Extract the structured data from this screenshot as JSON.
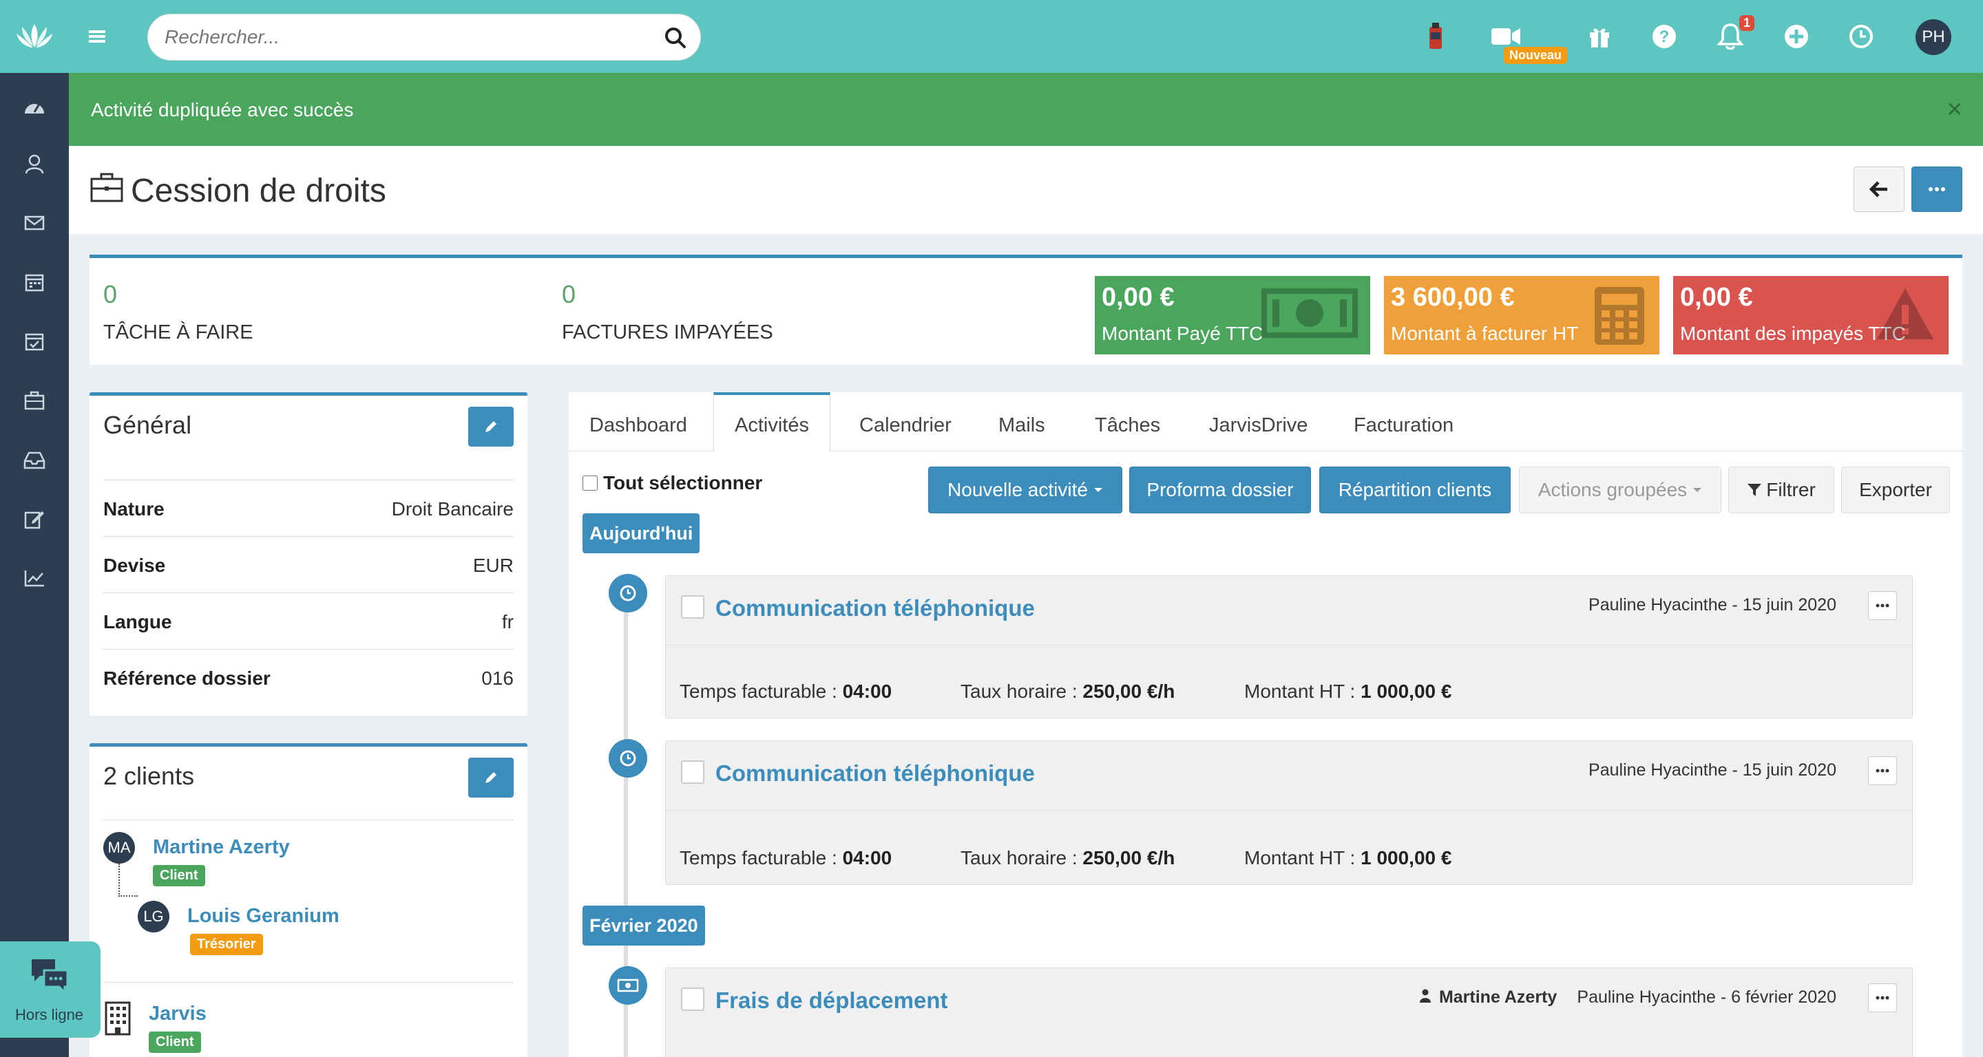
{
  "header": {
    "search_placeholder": "Rechercher...",
    "new_badge": "Nouveau",
    "notif_count": "1",
    "user_initials": "PH"
  },
  "alert": {
    "message": "Activité dupliquée avec succès",
    "close": "×"
  },
  "page": {
    "title": "Cession de droits"
  },
  "stats": {
    "tasks_count": "0",
    "tasks_label": "TÂCHE À FAIRE",
    "invoices_count": "0",
    "invoices_label": "FACTURES IMPAYÉES",
    "kpis": [
      {
        "value": "0,00 €",
        "label": "Montant Payé TTC",
        "color": "#4aa55d"
      },
      {
        "value": "3 600,00 €",
        "label": "Montant à facturer HT",
        "color": "#f0a03a"
      },
      {
        "value": "0,00 €",
        "label": "Montant des impayés TTC",
        "color": "#d9534f"
      }
    ]
  },
  "general": {
    "title": "Général",
    "rows": [
      {
        "key": "Nature",
        "value": "Droit Bancaire"
      },
      {
        "key": "Devise",
        "value": "EUR"
      },
      {
        "key": "Langue",
        "value": "fr"
      },
      {
        "key": "Référence dossier",
        "value": "016"
      }
    ]
  },
  "clients": {
    "title": "2 clients",
    "list": [
      {
        "initials": "MA",
        "name": "Martine Azerty",
        "role": "Client",
        "role_color": "#4aa55d"
      },
      {
        "initials": "LG",
        "name": "Louis Geranium",
        "role": "Trésorier",
        "role_color": "#f39c12"
      },
      {
        "name": "Jarvis",
        "role": "Client",
        "role_color": "#4aa55d"
      }
    ]
  },
  "chat": {
    "label": "Hors ligne"
  },
  "tabs": [
    "Dashboard",
    "Activités",
    "Calendrier",
    "Mails",
    "Tâches",
    "JarvisDrive",
    "Facturation"
  ],
  "toolbar": {
    "select_all": "Tout sélectionner",
    "new_activity": "Nouvelle activité",
    "proforma": "Proforma dossier",
    "repartition": "Répartition clients",
    "grouped_actions": "Actions groupées",
    "filter": "Filtrer",
    "export": "Exporter"
  },
  "timeline": {
    "today_label": "Aujourd'hui",
    "feb_label": "Février 2020",
    "activities": [
      {
        "title": "Communication téléphonique",
        "meta": "Pauline Hyacinthe - 15 juin 2020",
        "billable_label": "Temps facturable :",
        "billable_value": "04:00",
        "rate_label": "Taux horaire :",
        "rate_value": "250,00 €/h",
        "amount_label": "Montant HT :",
        "amount_value": "1 000,00 €"
      },
      {
        "title": "Communication téléphonique",
        "meta": "Pauline Hyacinthe - 15 juin 2020",
        "billable_label": "Temps facturable :",
        "billable_value": "04:00",
        "rate_label": "Taux horaire :",
        "rate_value": "250,00 €/h",
        "amount_label": "Montant HT :",
        "amount_value": "1 000,00 €"
      },
      {
        "title": "Frais de déplacement",
        "client": "Martine Azerty",
        "meta": "Pauline Hyacinthe - 6 février 2020"
      }
    ]
  }
}
